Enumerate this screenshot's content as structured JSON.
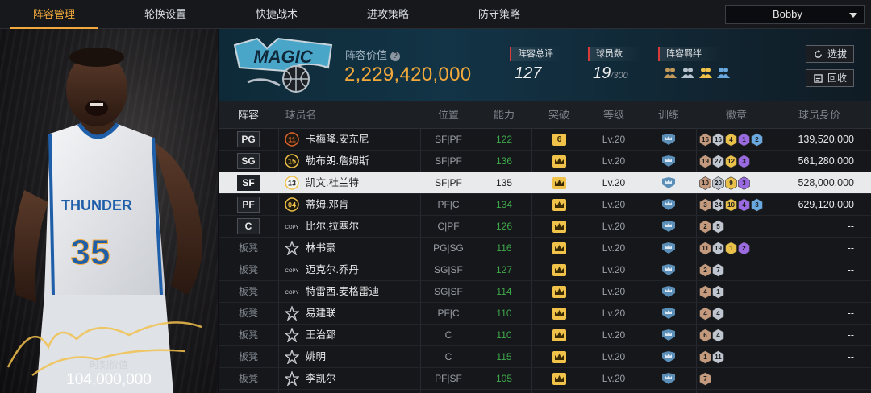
{
  "nav": {
    "tabs": [
      "阵容管理",
      "轮换设置",
      "快捷战术",
      "进攻策略",
      "防守策略"
    ],
    "active_tab": "阵容管理",
    "user": "Bobby"
  },
  "featured": {
    "jersey_team": "THUNDER",
    "jersey_number": "35",
    "market_value_label": "时刻价值",
    "market_value": "104,000,000"
  },
  "header": {
    "team_value_label": "阵容价值",
    "team_value": "2,229,420,000",
    "rating_label": "阵容总评",
    "rating": "127",
    "players_label": "球员数",
    "players_count": "19",
    "players_max": "/300",
    "bond_label": "阵容羁绊",
    "select_button": "选拔",
    "recycle_button": "回收",
    "accent_color": "#f2a93b"
  },
  "table": {
    "headers": [
      "阵容",
      "球员名",
      "位置",
      "能力",
      "突破",
      "等级",
      "训练",
      "徽章",
      "球员身价"
    ],
    "rows": [
      {
        "slot": "PG",
        "num": "11",
        "numtype": "orange",
        "name": "卡梅隆.安东尼",
        "pos": "SF|PF",
        "ability": "122",
        "break": "6",
        "level": "Lv.20",
        "badges": [
          "16",
          "16",
          "4",
          "1",
          "2"
        ],
        "value": "139,520,000"
      },
      {
        "slot": "SG",
        "num": "15",
        "numtype": "gold",
        "name": "勒布朗.詹姆斯",
        "pos": "SF|PF",
        "ability": "136",
        "break": "",
        "level": "Lv.20",
        "badges": [
          "19",
          "27",
          "12",
          "3"
        ],
        "value": "561,280,000"
      },
      {
        "slot": "SF",
        "num": "13",
        "numtype": "gold",
        "name": "凯文.杜兰特",
        "pos": "SF|PF",
        "ability": "135",
        "break": "",
        "level": "Lv.20",
        "badges": [
          "10",
          "20",
          "9",
          "3"
        ],
        "value": "528,000,000",
        "selected": true
      },
      {
        "slot": "PF",
        "num": "04",
        "numtype": "gold",
        "name": "蒂姆.邓肯",
        "pos": "PF|C",
        "ability": "134",
        "break": "",
        "level": "Lv.20",
        "badges": [
          "3",
          "24",
          "10",
          "4",
          "3"
        ],
        "value": "629,120,000"
      },
      {
        "slot": "C",
        "num": "COPY",
        "numtype": "copy",
        "name": "比尔.拉塞尔",
        "pos": "C|PF",
        "ability": "126",
        "break": "",
        "level": "Lv.20",
        "badges": [
          "2",
          "5"
        ],
        "value": "--"
      },
      {
        "slot": "板凳",
        "num": "star",
        "numtype": "star",
        "name": "林书豪",
        "pos": "PG|SG",
        "ability": "116",
        "break": "",
        "level": "Lv.20",
        "badges": [
          "11",
          "19",
          "1",
          "2"
        ],
        "value": "--"
      },
      {
        "slot": "板凳",
        "num": "COPY",
        "numtype": "copy",
        "name": "迈克尔.乔丹",
        "pos": "SG|SF",
        "ability": "127",
        "break": "",
        "level": "Lv.20",
        "badges": [
          "2",
          "7"
        ],
        "value": "--"
      },
      {
        "slot": "板凳",
        "num": "COPY",
        "numtype": "copy",
        "name": "特雷西.麦格雷迪",
        "pos": "SG|SF",
        "ability": "114",
        "break": "",
        "level": "Lv.20",
        "badges": [
          "4",
          "1"
        ],
        "value": "--"
      },
      {
        "slot": "板凳",
        "num": "star",
        "numtype": "star",
        "name": "易建联",
        "pos": "PF|C",
        "ability": "110",
        "break": "",
        "level": "Lv.20",
        "badges": [
          "4",
          "4"
        ],
        "value": "--"
      },
      {
        "slot": "板凳",
        "num": "star",
        "numtype": "star",
        "name": "王治郅",
        "pos": "C",
        "ability": "110",
        "break": "",
        "level": "Lv.20",
        "badges": [
          "6",
          "4"
        ],
        "value": "--"
      },
      {
        "slot": "板凳",
        "num": "star",
        "numtype": "star",
        "name": "姚明",
        "pos": "C",
        "ability": "115",
        "break": "",
        "level": "Lv.20",
        "badges": [
          "1",
          "11"
        ],
        "value": "--"
      },
      {
        "slot": "板凳",
        "num": "star",
        "numtype": "star",
        "name": "李凯尔",
        "pos": "PF|SF",
        "ability": "105",
        "break": "",
        "level": "Lv.20",
        "badges": [
          "7"
        ],
        "value": "--"
      }
    ]
  },
  "icons": {
    "help": "help-icon",
    "refresh": "refresh-icon",
    "recycle": "recycle-icon",
    "crown": "crown-icon",
    "training": "training-icon",
    "badge": "badge-hexagon-icon",
    "bond": "bond-players-icon"
  }
}
